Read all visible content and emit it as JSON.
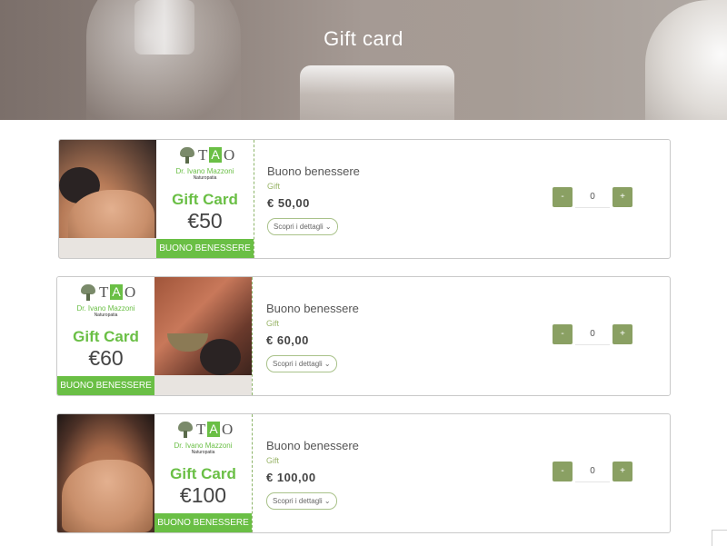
{
  "hero": {
    "title": "Gift card"
  },
  "logo": {
    "t": "T",
    "a": "A",
    "o": "O",
    "doctor": "Dr. Ivano Mazzoni",
    "subtitle": "Naturopatia"
  },
  "products": [
    {
      "card_title": "Gift Card",
      "card_amount": "€50",
      "card_band": "BUONO BENESSERE",
      "name": "Buono benessere",
      "category": "Gift",
      "price": "€ 50,00",
      "details_label": "Scopri i dettagli ⌄",
      "qty": {
        "minus": "-",
        "value": "0",
        "plus": "+"
      }
    },
    {
      "card_title": "Gift Card",
      "card_amount": "€60",
      "card_band": "BUONO BENESSERE",
      "name": "Buono benessere",
      "category": "Gift",
      "price": "€ 60,00",
      "details_label": "Scopri i dettagli ⌄",
      "qty": {
        "minus": "-",
        "value": "0",
        "plus": "+"
      }
    },
    {
      "card_title": "Gift Card",
      "card_amount": "€100",
      "card_band": "BUONO BENESSERE",
      "name": "Buono benessere",
      "category": "Gift",
      "price": "€ 100,00",
      "details_label": "Scopri i dettagli ⌄",
      "qty": {
        "minus": "-",
        "value": "0",
        "plus": "+"
      }
    }
  ],
  "colors": {
    "brand_green": "#6abf45",
    "button_green": "#8aa063",
    "category_green": "#9ab56a"
  }
}
